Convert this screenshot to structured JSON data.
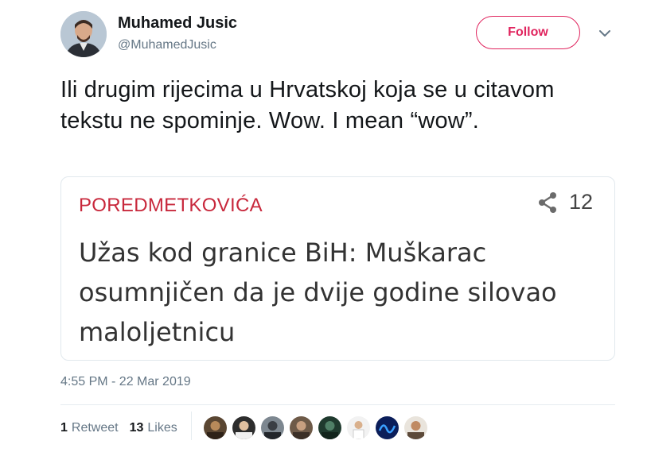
{
  "author": {
    "name": "Muhamed Jusic",
    "handle": "@MuhamedJusic",
    "avatar_icon": "user-avatar"
  },
  "follow_label": "Follow",
  "tweet_text": "Ili drugim rijecima u Hrvatskoj koja se u citavom tekstu ne spominje. Wow. I mean “wow”.",
  "card": {
    "kicker": "POREDMETKOVIĆA",
    "share_count": "12",
    "headline": "Užas kod granice BiH: Muškarac osumnjičen da je dvije godine silovao maloljetnicu"
  },
  "timestamp": "4:55 PM - 22 Mar 2019",
  "stats": {
    "retweets_count": "1",
    "retweets_label": "Retweet",
    "likes_count": "13",
    "likes_label": "Likes"
  },
  "colors": {
    "accent": "#e0245e",
    "kicker": "#c8283c",
    "muted": "#657786"
  }
}
